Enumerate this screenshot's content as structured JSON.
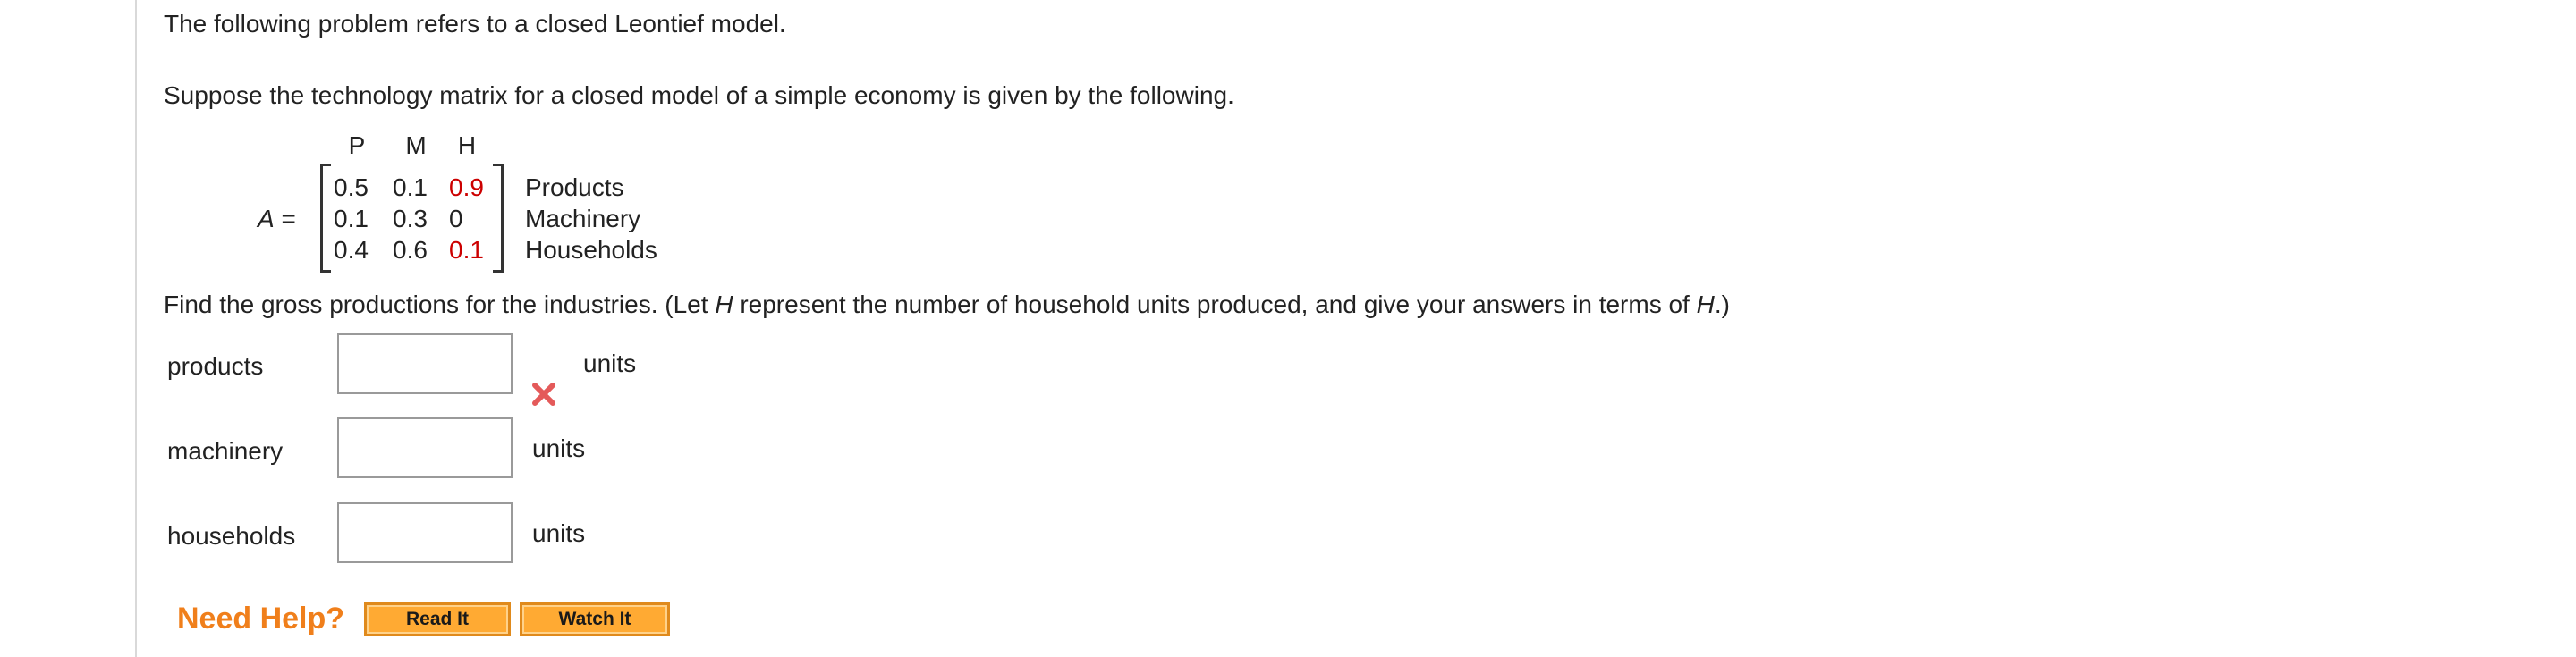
{
  "intro": "The following problem refers to a closed Leontief model.",
  "setup": "Suppose the technology matrix for a closed model of a simple economy is given by the following.",
  "matrix": {
    "label": "A =",
    "col_headers": [
      "P",
      "M",
      "H"
    ],
    "rows": [
      [
        "0.5",
        "0.1",
        "0.9"
      ],
      [
        "0.1",
        "0.3",
        "0"
      ],
      [
        "0.4",
        "0.6",
        "0.1"
      ]
    ],
    "row_labels": [
      "Products",
      "Machinery",
      "Households"
    ],
    "highlight_color": "#cc0000"
  },
  "question": {
    "part1": "Find the gross productions for the industries. (Let ",
    "var1": "H",
    "part2": " represent the number of household units produced, and give your answers in terms of ",
    "var2": "H",
    "part3": ".)"
  },
  "answers": [
    {
      "label": "products",
      "value": "",
      "unit": "units",
      "status": "incorrect"
    },
    {
      "label": "machinery",
      "value": "",
      "unit": "units"
    },
    {
      "label": "households",
      "value": "",
      "unit": "units"
    }
  ],
  "help": {
    "label": "Need Help?",
    "read_it": "Read It",
    "watch_it": "Watch It",
    "accent_color": "#f07f1b"
  }
}
